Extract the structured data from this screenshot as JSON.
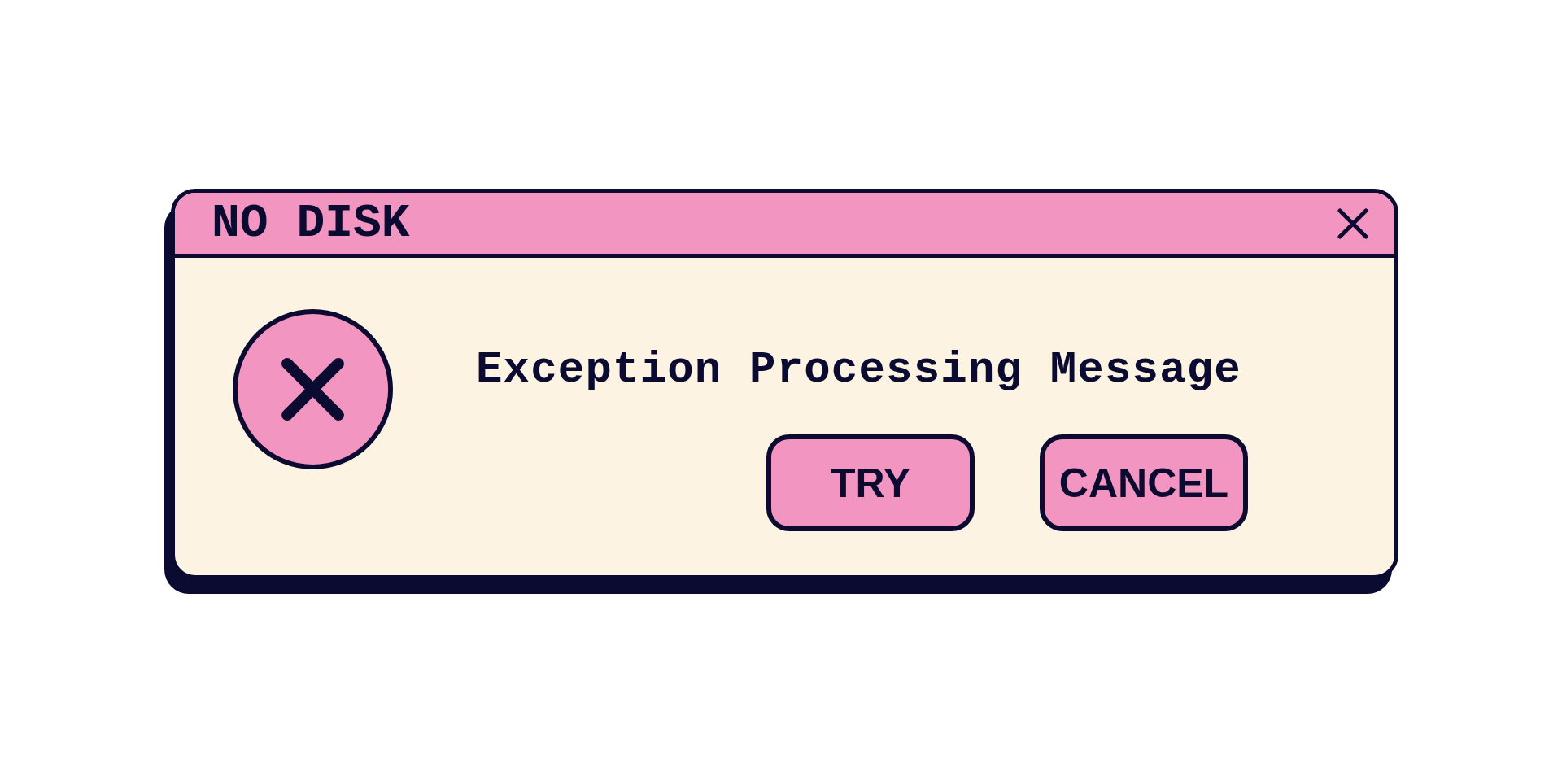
{
  "window": {
    "title": "NO DISK"
  },
  "message": "Exception Processing Message",
  "buttons": [
    {
      "label": "TRY"
    },
    {
      "label": "CANCEL"
    }
  ]
}
